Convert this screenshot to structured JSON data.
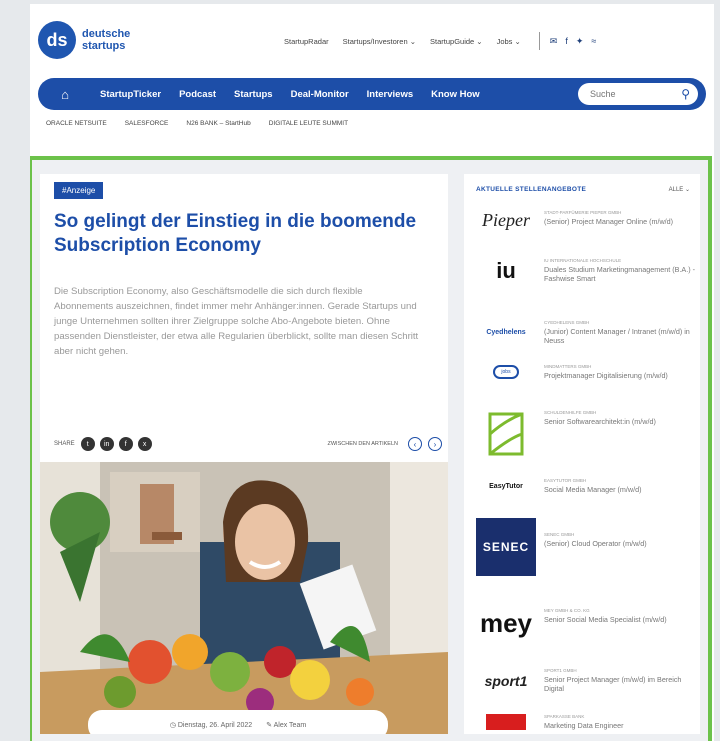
{
  "brand": {
    "logo_initials": "ds",
    "name_line1": "deutsche",
    "name_line2": "startups"
  },
  "top_nav": [
    "StartupRadar",
    "Startups/Investoren ⌄",
    "StartupGuide ⌄",
    "Jobs ⌄"
  ],
  "social_icons": [
    "mail-icon",
    "facebook-icon",
    "twitter-icon",
    "rss-icon"
  ],
  "main_nav": {
    "items": [
      "StartupTicker",
      "Podcast",
      "Startups",
      "Deal-Monitor",
      "Interviews",
      "Know How"
    ],
    "search_placeholder": "Suche"
  },
  "sub_nav": [
    "ORACLE NETSUITE",
    "SALESFORCE",
    "N26 BANK – StartHub",
    "DIGITALE LEUTE SUMMIT"
  ],
  "article": {
    "tag": "#Anzeige",
    "title": "So gelingt der Einstieg in die boomende Subscription Economy",
    "lead": "Die Subscription Economy, also Geschäftsmodelle die sich durch flexible Abonnements auszeichnen, findet immer mehr Anhänger:innen. Gerade Startups und junge Unternehmen sollten ihrer Zielgruppe solche Abo-Angebote bieten. Ohne passenden Dienstleister, der etwa alle Regularien überblickt, sollte man diesen Schritt aber nicht gehen.",
    "share_label": "SHARE",
    "next_label": "ZWISCHEN DEN ARTIKELN",
    "date": "Dienstag, 26. April 2022",
    "author": "Alex Team"
  },
  "jobs": {
    "title": "AKTUELLE STELLENANGEBOTE",
    "all_label": "ALLE ⌄",
    "items": [
      {
        "logo": "Pieper",
        "company": "Stadt-Parfümerie Pieper GmbH",
        "title": "(Senior) Project Manager Online (m/w/d)"
      },
      {
        "logo": "iu",
        "company": "IU Internationale Hochschule",
        "title": "Duales Studium Marketingmanagement (B.A.) - Fashwise Smart"
      },
      {
        "logo": "Cyedhelens",
        "company": "Cyedhelens GmbH",
        "title": "(Junior) Content Manager / Intranet (m/w/d) in Neuss"
      },
      {
        "logo": "jobs",
        "company": "Mindmatters GmbH",
        "title": "Projektmanager Digitalisierung (m/w/d)"
      },
      {
        "logo": "",
        "company": "Schuldenhilfe GmbH",
        "title": "Senior Softwarearchitekt:in (m/w/d)"
      },
      {
        "logo": "EasyTutor",
        "company": "EasyTutor GmbH",
        "title": "Social Media Manager (m/w/d)"
      },
      {
        "logo": "SENEC",
        "company": "SENEC GmbH",
        "title": "(Senior) Cloud Operator (m/w/d)"
      },
      {
        "logo": "mey",
        "company": "Mey GmbH & Co. KG",
        "title": "Senior Social Media Specialist (m/w/d)"
      },
      {
        "logo": "sport1",
        "company": "Sport1 GmbH",
        "title": "Senior Project Manager (m/w/d) im Bereich Digital"
      },
      {
        "logo": "",
        "company": "Sparkasse Bank",
        "title": "Marketing Data Engineer"
      }
    ]
  },
  "colors": {
    "brand_blue": "#1d4ea8",
    "frame_green": "#6cc24a"
  }
}
